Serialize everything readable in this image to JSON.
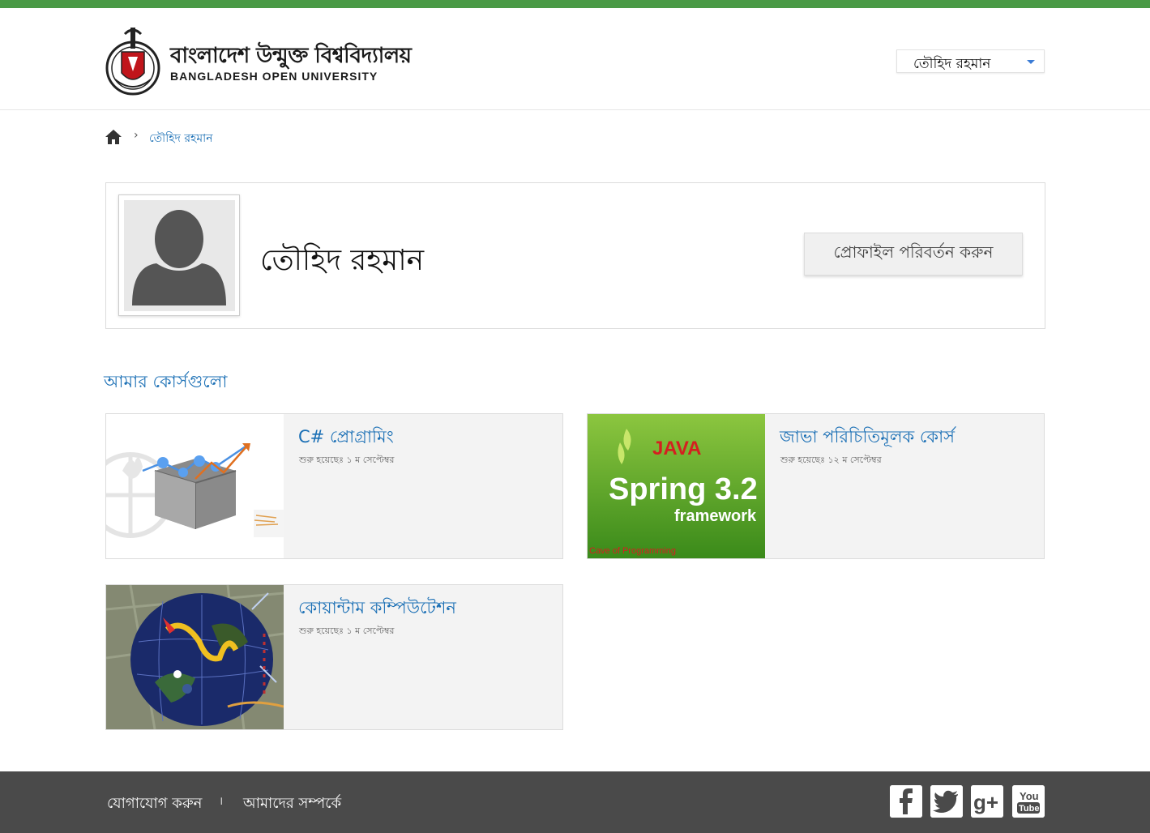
{
  "header": {
    "logo_bangla": "বাংলাদেশ উন্মুক্ত বিশ্ববিদ্যালয়",
    "logo_english": "BANGLADESH OPEN UNIVERSITY",
    "user_menu_name": "তৌহিদ রহমান",
    "accent_color": "#4a9a46"
  },
  "breadcrumb": {
    "home_icon": "home-icon",
    "separator": "›",
    "current": "তৌহিদ রহমান"
  },
  "profile": {
    "name": "তৌহিদ রহমান",
    "edit_button": "প্রোফাইল পরিবর্তন করুন",
    "avatar_icon": "user-silhouette-icon"
  },
  "courses_section": {
    "title": "আমার কোর্সগুলো",
    "courses": [
      {
        "title": "C# প্রোগ্রামিং",
        "date": "শুরু হয়েছেঃ ১ ম সেপ্টেম্বর",
        "thumbnail": "programming-toolbox-image"
      },
      {
        "title": "জাভা পরিচিতিমূলক কোর্স",
        "date": "শুরু হয়েছেঃ ১২ ম সেপ্টেম্বর",
        "thumbnail": "java-spring-image",
        "thumb_text": {
          "java": "JAVA",
          "spring": "Spring 3.2",
          "framework": "framework",
          "credit": "Cave of Programming"
        }
      },
      {
        "title": "কোয়ান্টাম কম্পিউটেশন",
        "date": "শুরু হয়েছেঃ ১ ম সেপ্টেম্বর",
        "thumbnail": "globe-network-image"
      }
    ]
  },
  "footer": {
    "contact": "যোগাযোগ করুন",
    "separator": "।",
    "about": "আমাদের সম্পর্কে",
    "social_icons": [
      "facebook-icon",
      "twitter-icon",
      "google-plus-icon",
      "youtube-icon"
    ],
    "youtube_you": "You",
    "youtube_tube": "Tube"
  }
}
